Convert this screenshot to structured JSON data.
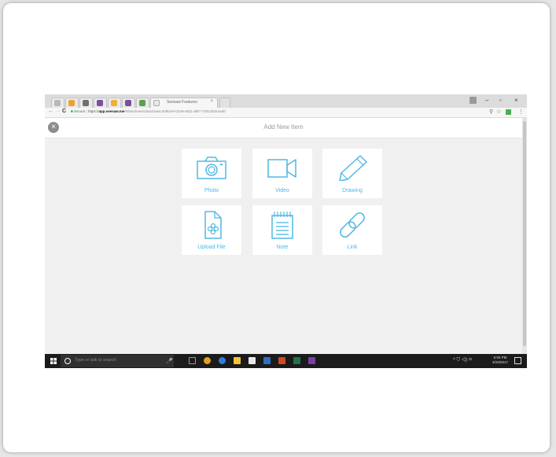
{
  "browser": {
    "tabs": [
      {
        "icon": "gear-icon",
        "color": "#b8b8b8"
      },
      {
        "icon": "orange-app-icon",
        "color": "#f0a030"
      },
      {
        "icon": "home-icon",
        "color": "#707070"
      },
      {
        "icon": "tech-app-icon",
        "color": "#7a4fa0"
      },
      {
        "icon": "star-app-icon",
        "color": "#f0b030"
      },
      {
        "icon": "tech-app-icon",
        "color": "#7a4fa0"
      },
      {
        "icon": "green-app-icon",
        "color": "#5aa050"
      }
    ],
    "active_tab_title": "Seesaw Features",
    "active_tab_close": "×",
    "window_controls": {
      "minimize": "–",
      "maximize": "▫",
      "close": "×"
    },
    "nav": {
      "back": "←",
      "forward": "→",
      "reload": "C"
    },
    "url": {
      "lock": "🔒",
      "secure_label": "Secure",
      "scheme": "https://",
      "host": "app.seesaw.me",
      "path": "/#/item/new/class/class.0ef91e0-01e9-4821-af67-7391252e1edd"
    },
    "toolbar_icons": {
      "extensions": "⚲",
      "bookmark": "☆",
      "extension_color": "#4caf50",
      "menu": "⋮"
    }
  },
  "page": {
    "close_label": "×",
    "title": "Add New Item",
    "accent_color": "#4fb8e4",
    "options": [
      {
        "label": "Photo",
        "icon": "camera-icon"
      },
      {
        "label": "Video",
        "icon": "video-camera-icon"
      },
      {
        "label": "Drawing",
        "icon": "pencil-icon"
      },
      {
        "label": "Upload File",
        "icon": "upload-file-icon"
      },
      {
        "label": "Note",
        "icon": "notepad-icon"
      },
      {
        "label": "Link",
        "icon": "link-icon"
      }
    ]
  },
  "taskbar": {
    "search_placeholder": "Type or talk to search",
    "mic": "🎤",
    "apps": [
      {
        "icon": "task-view-icon",
        "color": "#9a9a9a"
      },
      {
        "icon": "chrome-icon",
        "color": "#e0a020"
      },
      {
        "icon": "edge-icon",
        "color": "#2f7fd8"
      },
      {
        "icon": "file-explorer-icon",
        "color": "#f3c33a"
      },
      {
        "icon": "store-icon",
        "color": "#e8e8e8"
      },
      {
        "icon": "outlook-icon",
        "color": "#2f6fc0"
      },
      {
        "icon": "powerpoint-icon",
        "color": "#d24726"
      },
      {
        "icon": "excel-icon",
        "color": "#217346"
      },
      {
        "icon": "onenote-icon",
        "color": "#7a3fa0"
      }
    ],
    "tray": "^ ⛉ ◁) ▭",
    "time": "6:50 PM",
    "date": "3/29/2017"
  }
}
